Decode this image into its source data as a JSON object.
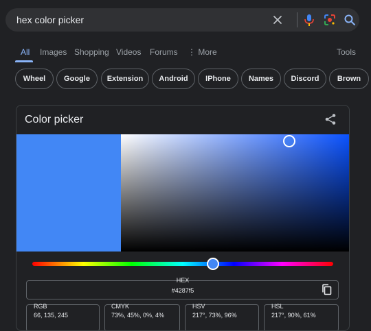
{
  "search": {
    "query": "hex color picker"
  },
  "tabs": [
    {
      "label": "All"
    },
    {
      "label": "Images"
    },
    {
      "label": "Shopping"
    },
    {
      "label": "Videos"
    },
    {
      "label": "Forums"
    },
    {
      "label": "More"
    },
    {
      "label": "Tools"
    }
  ],
  "chips": [
    "Wheel",
    "Google",
    "Extension",
    "Android",
    "IPhone",
    "Names",
    "Discord",
    "Brown"
  ],
  "picker": {
    "title": "Color picker",
    "selected_color": "#4287f5",
    "hue_position_fraction": 0.6,
    "hex": {
      "label": "HEX",
      "value": "#4287f5"
    },
    "rgb": {
      "label": "RGB",
      "value": "66, 135, 245"
    },
    "cmyk": {
      "label": "CMYK",
      "value": "73%, 45%, 0%, 4%"
    },
    "hsv": {
      "label": "HSV",
      "value": "217°, 73%, 96%"
    },
    "hsl": {
      "label": "HSL",
      "value": "217°, 90%, 61%"
    }
  },
  "colors": {
    "background": "#202124",
    "accent": "#8ab4f8",
    "surface": "#303134"
  }
}
